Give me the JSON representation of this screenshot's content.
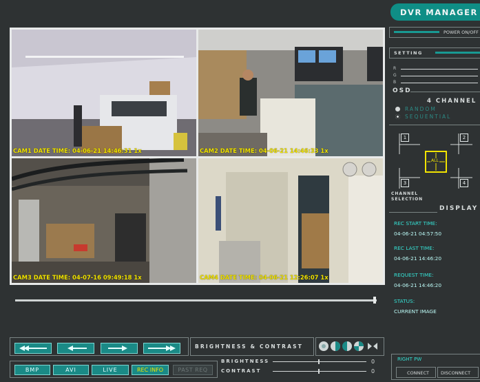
{
  "app": {
    "title": "DVR MANAGER",
    "power_label": "POWER ON/OFF",
    "setting_label": "SETTING",
    "rgb_labels": [
      "R",
      "G",
      "B"
    ],
    "osd_label": "OSD",
    "channel_mode_title": "4 CHANNEL",
    "mode_options": [
      {
        "label": "RANDOM",
        "selected": false
      },
      {
        "label": "SEQUENTIAL",
        "selected": true
      }
    ],
    "channel_selection_label": "CHANNEL SELECTION",
    "channel_numbers": [
      "1",
      "2",
      "3",
      "4"
    ],
    "all_label": "ALL",
    "display_title": "DISPLAY"
  },
  "cameras": [
    {
      "caption": "CAM1 DATE TIME: 04-06-21 14:46:31   1x"
    },
    {
      "caption": "CAM2 DATE TIME: 04-06-21 14:46:33   1x"
    },
    {
      "caption": "CAM3 DATE TIME: 04-07-16 09:49:18   1x"
    },
    {
      "caption": "CAM4 DATE TIME: 04-06-21 12:26:07   1x"
    }
  ],
  "display_info": {
    "rec_start_label": "REC START TIME:",
    "rec_start_value": "04-06-21  04:57:50",
    "rec_last_label": "REC LAST TIME:",
    "rec_last_value": "04-06-21  14:46:20",
    "request_label": "REQUEST TIME:",
    "request_value": "04-06-21  14:46:20",
    "status_label": "STATUS:",
    "status_value": "CURRENT IMAGE"
  },
  "controls": {
    "brightness_contrast_title": "BRIGHTNESS & CONTRAST",
    "brightness_label": "BRIGHTNESS",
    "contrast_label": "CONTRAST",
    "brightness_value": "0",
    "contrast_value": "0",
    "buttons": [
      "BMP",
      "AVI",
      "LIVE",
      "REC INFO",
      "PAST REQ"
    ]
  },
  "right_pw": {
    "label": "RIGHT PW",
    "connect": "CONNECT",
    "disconnect": "DISCONNECT"
  },
  "colors": {
    "accent": "#1a8a86",
    "teal_text": "#2bd2c7",
    "caption": "#f2e400",
    "background": "#2e3233"
  }
}
